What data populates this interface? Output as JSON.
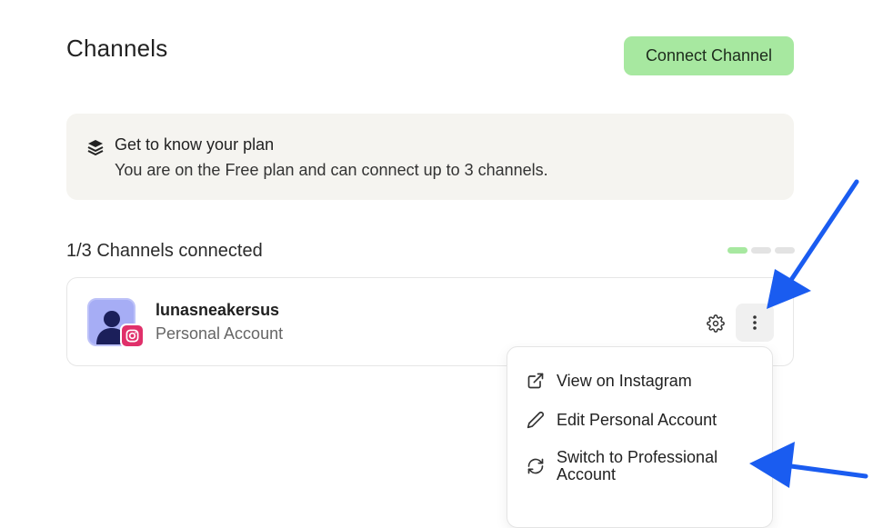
{
  "header": {
    "title": "Channels",
    "connect_label": "Connect Channel"
  },
  "plan": {
    "title": "Get to know your plan",
    "description": "You are on the Free plan and can connect up to 3 channels."
  },
  "channels": {
    "count_label": "1/3 Channels connected",
    "connected": 1,
    "limit": 3,
    "items": [
      {
        "name": "lunasneakersus",
        "type": "Personal Account",
        "network_icon": "instagram-icon"
      }
    ]
  },
  "menu": {
    "items": [
      {
        "label": "View on Instagram",
        "icon": "external-link-icon"
      },
      {
        "label": "Edit Personal Account",
        "icon": "pencil-icon"
      },
      {
        "label": "Switch to Professional Account",
        "icon": "refresh-icon"
      }
    ]
  },
  "colors": {
    "accent_green": "#a7e8a0",
    "instagram_pink": "#e0306a",
    "avatar_purple": "#a6adf5",
    "annotation_blue": "#1a5cf0"
  }
}
